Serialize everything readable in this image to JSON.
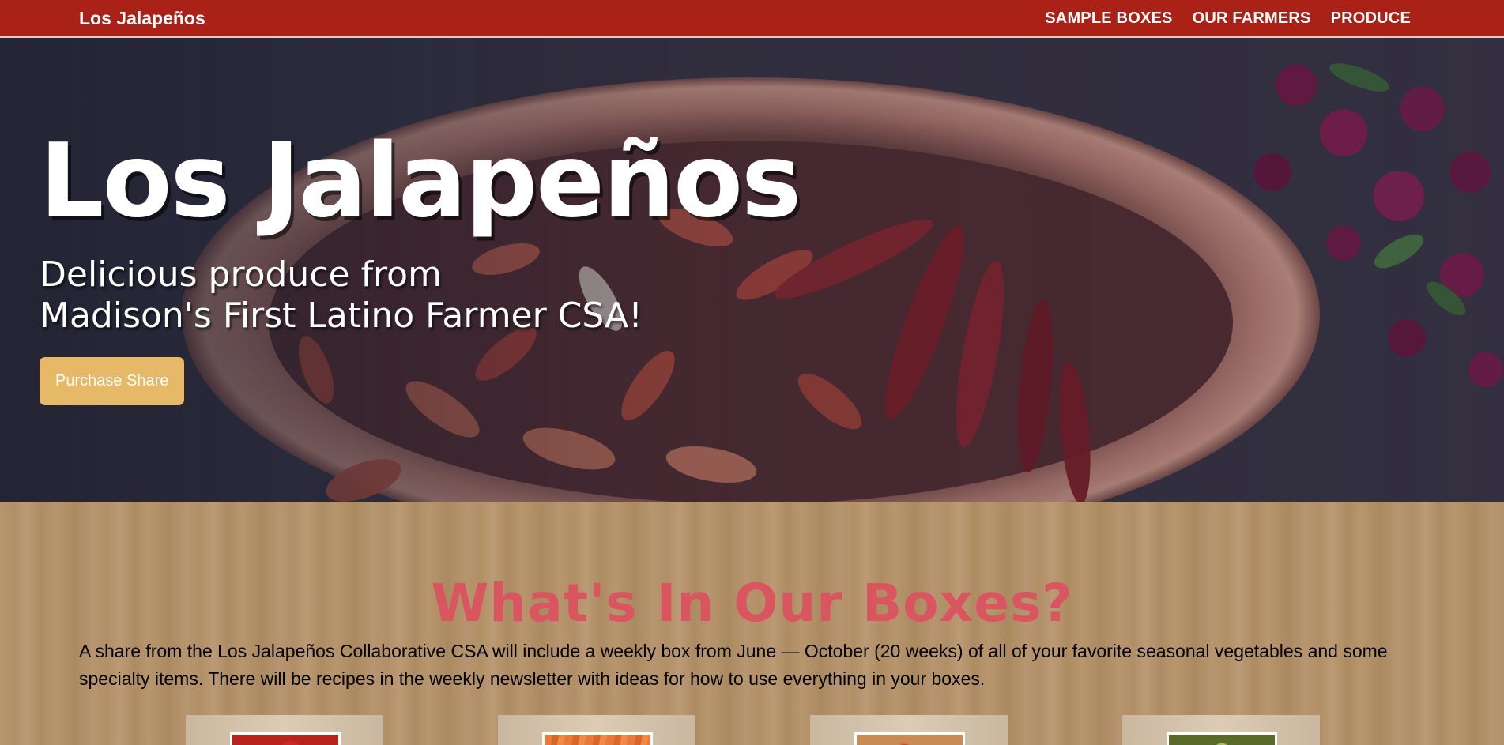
{
  "navbar": {
    "brand": "Los Jalapeños",
    "links": [
      "SAMPLE BOXES",
      "OUR FARMERS",
      "PRODUCE"
    ]
  },
  "hero": {
    "title": "Los Jalapeños",
    "subtitle_line1": "Delicious produce from",
    "subtitle_line2": "Madison's First Latino Farmer CSA!",
    "button_label": "Purchase Share"
  },
  "boxes_section": {
    "title": "What's In Our Boxes?",
    "description": "A share from the Los Jalapeños Collaborative CSA will include a weekly box from June — October (20 weeks) of all of your favorite seasonal vegetables and some specialty items. There will be recipes in the weekly newsletter with ideas for how to use everything in your boxes."
  },
  "colors": {
    "navbar": "#a92117",
    "button": "#e5b967",
    "section_title": "#d95560",
    "wood": "#b39268"
  },
  "box_thumbnails": [
    "strawberries",
    "carrots",
    "mixed-vegetables",
    "tomatillos"
  ]
}
